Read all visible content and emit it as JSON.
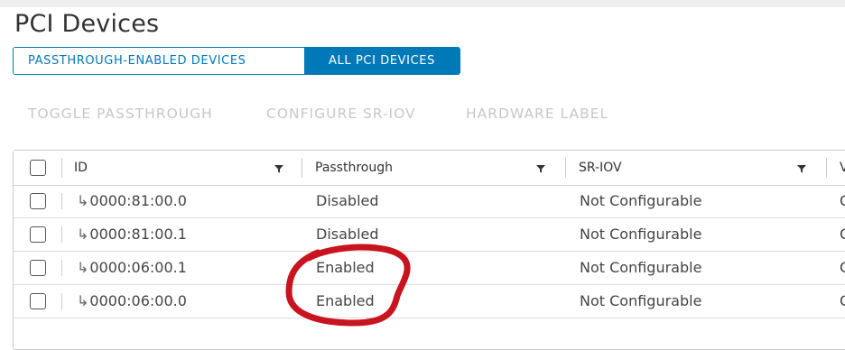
{
  "page": {
    "title": "PCI Devices"
  },
  "tabs": [
    {
      "label": "PASSTHROUGH-ENABLED DEVICES",
      "active": false
    },
    {
      "label": "ALL PCI DEVICES",
      "active": true
    }
  ],
  "actions": [
    {
      "label": "TOGGLE PASSTHROUGH",
      "enabled": false
    },
    {
      "label": "CONFIGURE SR-IOV",
      "enabled": false
    },
    {
      "label": "HARDWARE LABEL",
      "enabled": false
    }
  ],
  "grid": {
    "columns": [
      {
        "label": "ID",
        "icon": "filter-icon"
      },
      {
        "label": "Passthrough",
        "icon": "filter-icon"
      },
      {
        "label": "SR-IOV",
        "icon": "filter-icon"
      },
      {
        "label": "V"
      }
    ],
    "rows": [
      {
        "id": "0000:81:00.0",
        "passthrough": "Disabled",
        "sriov": "Not Configurable",
        "extra": "C"
      },
      {
        "id": "0000:81:00.1",
        "passthrough": "Disabled",
        "sriov": "Not Configurable",
        "extra": "C"
      },
      {
        "id": "0000:06:00.1",
        "passthrough": "Enabled",
        "sriov": "Not Configurable",
        "extra": "C"
      },
      {
        "id": "0000:06:00.0",
        "passthrough": "Enabled",
        "sriov": "Not Configurable",
        "extra": "C"
      }
    ],
    "child_arrow_glyph": "↳"
  },
  "colors": {
    "accent": "#0079b8",
    "annotation": "#c8141e",
    "disabled_text": "#c7c7c7"
  }
}
